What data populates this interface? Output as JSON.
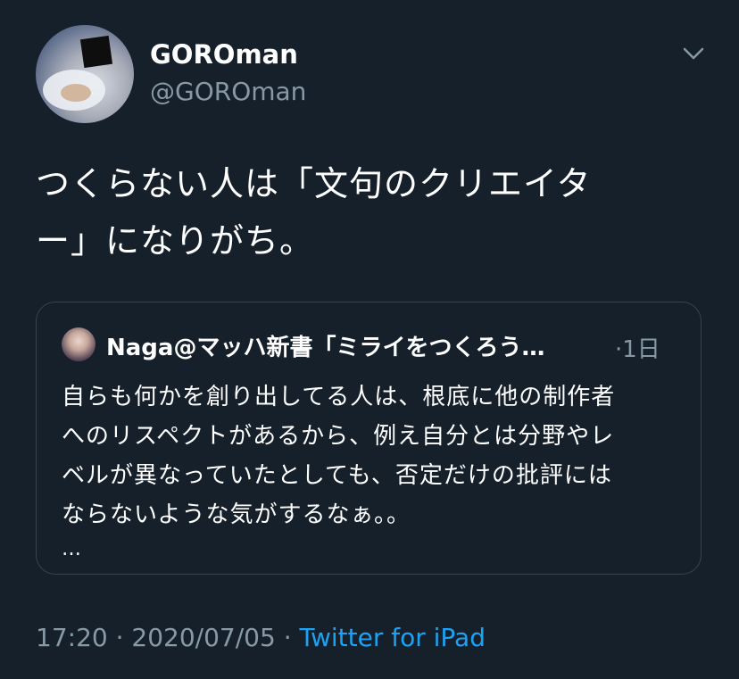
{
  "author": {
    "display_name": "GOROman",
    "handle": "@GOROman"
  },
  "tweet": {
    "text_line1": "つくらない人は「文句のクリエイタ",
    "text_line2": "ー」になりがち。"
  },
  "quoted": {
    "display_name": "Naga@マッハ新書「ミライをつくろう…",
    "time": "·1日",
    "text_line1": "自らも何かを創り出してる人は、根底に他の制作者",
    "text_line2": "へのリスペクトがあるから、例え自分とは分野やレ",
    "text_line3": "ベルが異なっていたとしても、否定だけの批評には",
    "text_line4": "ならないような気がするなぁ。。",
    "more": "…"
  },
  "meta": {
    "time": "17:20",
    "sep1": " · ",
    "date": "2020/07/05",
    "sep2": " · ",
    "source": "Twitter for iPad"
  },
  "colors": {
    "background": "#15202b",
    "secondary_text": "#8899a6",
    "link": "#1da1f2",
    "border": "#38444d"
  },
  "icons": {
    "menu": "chevron-down-icon"
  }
}
